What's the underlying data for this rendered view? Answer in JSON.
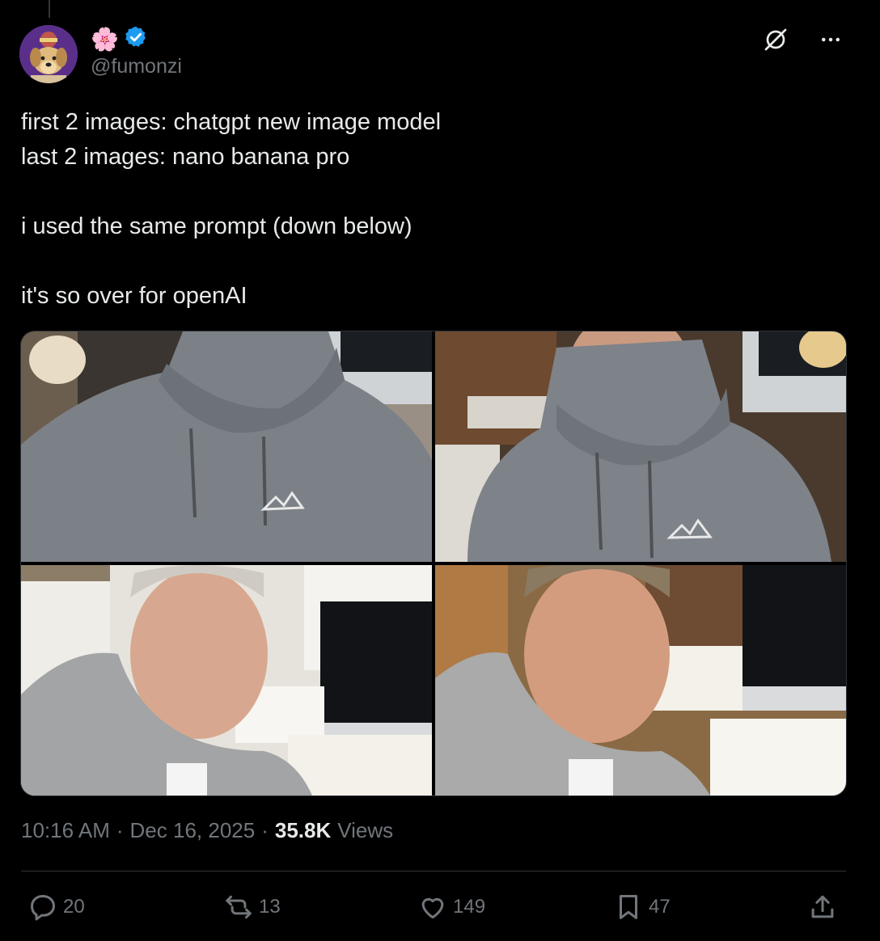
{
  "author": {
    "display_emoji": "🌸",
    "handle": "@fumonzi",
    "verified": true,
    "avatar_icon": "dog-avatar-icon"
  },
  "tweet": {
    "text": "first 2 images: chatgpt new image model\nlast 2 images: nano banana pro\n\ni used the same prompt (down below)\n\nit's so over for openAI"
  },
  "media": [
    {
      "alt": "image-1"
    },
    {
      "alt": "image-2"
    },
    {
      "alt": "image-3"
    },
    {
      "alt": "image-4"
    }
  ],
  "meta": {
    "time": "10:16 AM",
    "sep1": "·",
    "date": "Dec 16, 2025",
    "sep2": "·",
    "views_count": "35.8K",
    "views_label": "Views"
  },
  "actions": {
    "replies": "20",
    "reposts": "13",
    "likes": "149",
    "bookmarks": "47"
  },
  "colors": {
    "background": "#000000",
    "text": "#e7e9ea",
    "secondary": "#71767b",
    "verified": "#1d9bf0",
    "divider": "#2f3336"
  }
}
